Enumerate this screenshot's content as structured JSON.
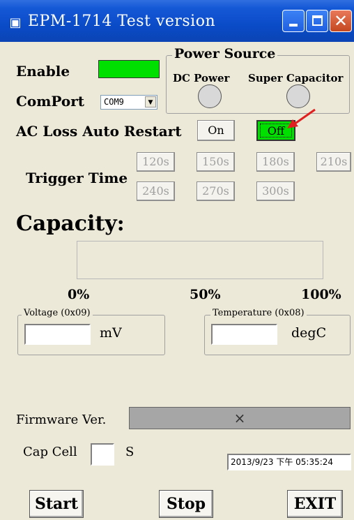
{
  "window": {
    "title": "EPM-1714 Test version",
    "app_icon": "app-icon",
    "controls": {
      "minimize_icon": "minimize-icon",
      "maximize_icon": "maximize-icon",
      "close_glyph": "✕"
    }
  },
  "enable": {
    "label": "Enable",
    "indicator_color": "#00e000"
  },
  "comport": {
    "label": "ComPort",
    "selected": "COM9",
    "arrow": "▼"
  },
  "power_source": {
    "title": "Power Source",
    "dc_label": "DC Power",
    "cap_label": "Super Capacitor"
  },
  "ac_loss": {
    "label": "AC Loss Auto Restart",
    "on_label": "On",
    "off_label": "Off",
    "off_active_color": "#00e000"
  },
  "trigger_time": {
    "label": "Trigger Time",
    "options": [
      "120s",
      "150s",
      "180s",
      "210s",
      "240s",
      "270s",
      "300s"
    ]
  },
  "capacity": {
    "label": "Capacity:",
    "level": 0,
    "scale": [
      "0%",
      "50%",
      "100%"
    ]
  },
  "voltage": {
    "group_title": "Voltage (0x09)",
    "value": "",
    "unit": "mV"
  },
  "temperature": {
    "group_title": "Temperature (0x08)",
    "value": "",
    "unit": "degC"
  },
  "firmware": {
    "label": "Firmware Ver.",
    "value": "×"
  },
  "cap_cell": {
    "label": "Cap Cell",
    "value": "",
    "unit": "S"
  },
  "datetime": "2013/9/23 下午 05:35:24",
  "buttons": {
    "start": "Start",
    "stop": "Stop",
    "exit": "EXIT"
  },
  "colors": {
    "titlebar": "#0a4bc8",
    "window_bg": "#ece9d8",
    "arrow": "#e02020"
  }
}
